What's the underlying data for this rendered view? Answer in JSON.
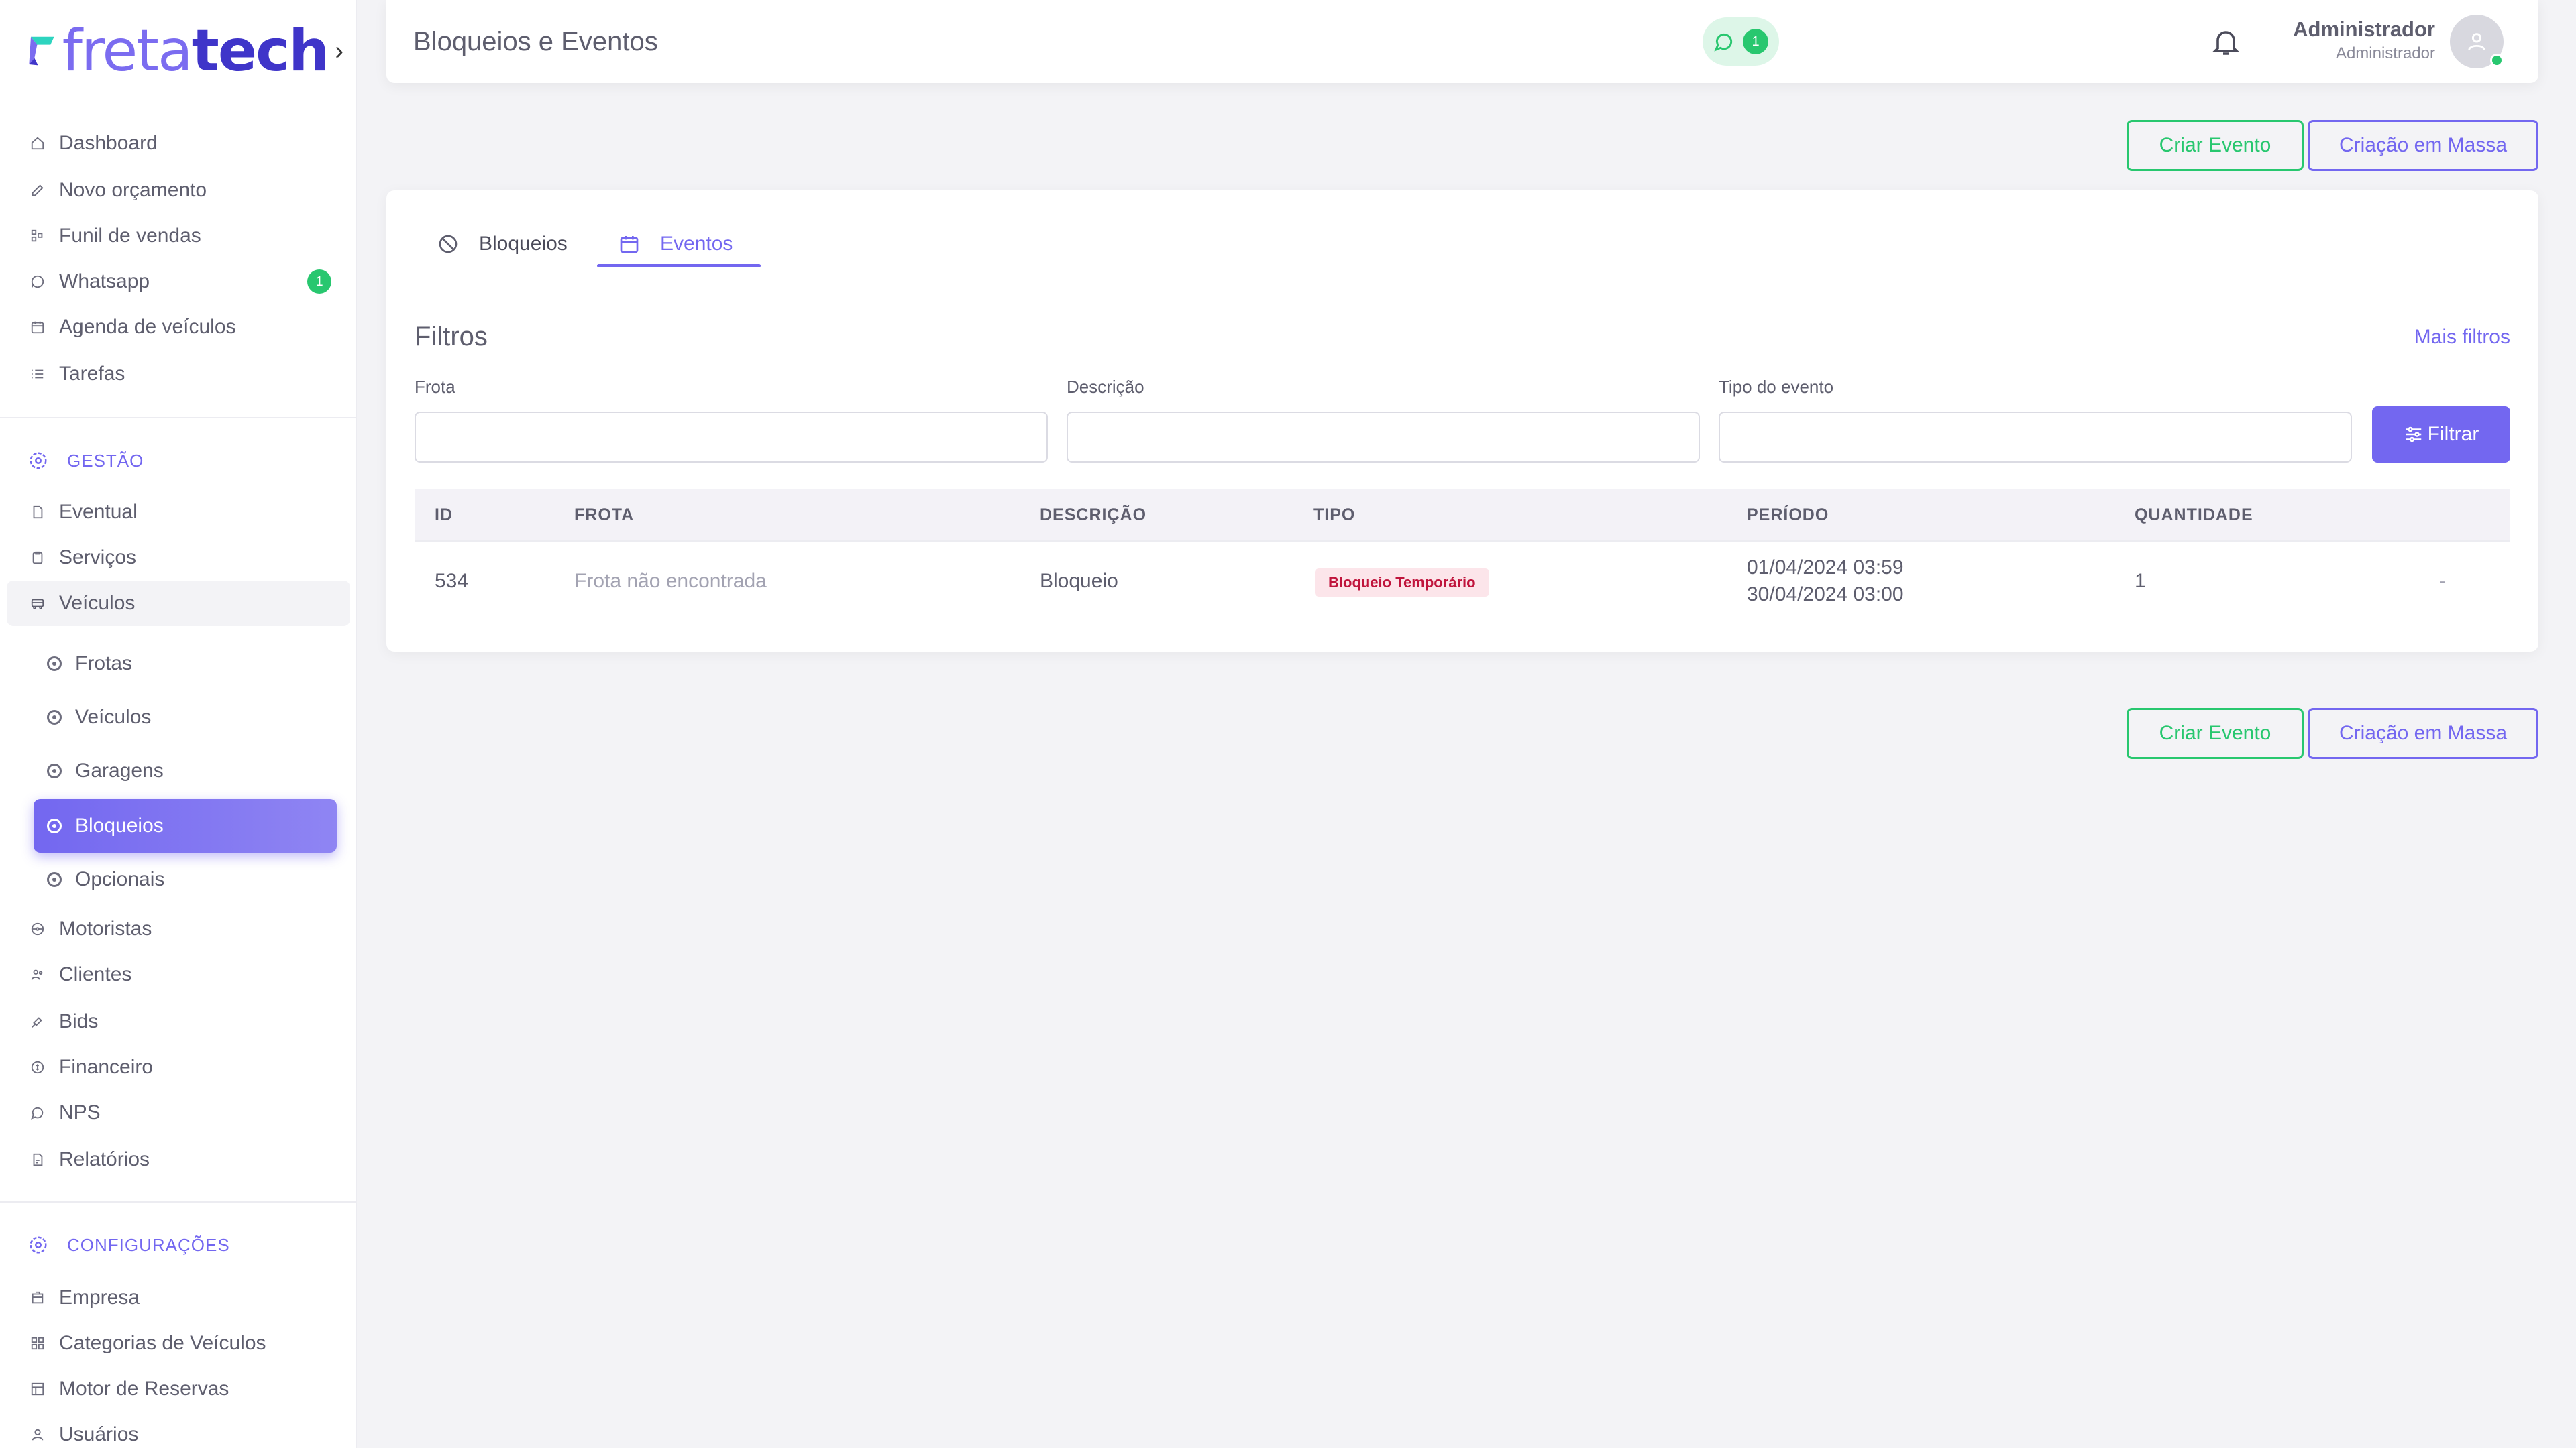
{
  "logo": {
    "part1": "freta",
    "part2": "tech",
    "chevron": "›"
  },
  "sidebar": {
    "items": [
      {
        "label": "Dashboard",
        "icon": "home-icon"
      },
      {
        "label": "Novo orçamento",
        "icon": "edit-icon"
      },
      {
        "label": "Funil de vendas",
        "icon": "funnel-icon"
      },
      {
        "label": "Whatsapp",
        "icon": "whatsapp-icon",
        "badge": "1"
      },
      {
        "label": "Agenda de veículos",
        "icon": "calendar-icon"
      },
      {
        "label": "Tarefas",
        "icon": "list-icon"
      }
    ],
    "section_gestao": "GESTÃO",
    "gestao_items": [
      {
        "label": "Eventual",
        "icon": "file-icon"
      },
      {
        "label": "Serviços",
        "icon": "clipboard-icon"
      },
      {
        "label": "Veículos",
        "icon": "bus-icon"
      }
    ],
    "veiculos_sub": [
      {
        "label": "Frotas"
      },
      {
        "label": "Veículos"
      },
      {
        "label": "Garagens"
      },
      {
        "label": "Bloqueios"
      },
      {
        "label": "Opcionais"
      }
    ],
    "gestao_more": [
      {
        "label": "Motoristas",
        "icon": "steering-icon"
      },
      {
        "label": "Clientes",
        "icon": "users-icon"
      },
      {
        "label": "Bids",
        "icon": "gavel-icon"
      },
      {
        "label": "Financeiro",
        "icon": "coin-icon"
      },
      {
        "label": "NPS",
        "icon": "chat-icon"
      },
      {
        "label": "Relatórios",
        "icon": "report-icon"
      }
    ],
    "section_config": "CONFIGURAÇÕES",
    "config_items": [
      {
        "label": "Empresa",
        "icon": "building-icon"
      },
      {
        "label": "Categorias de Veículos",
        "icon": "grid-icon"
      },
      {
        "label": "Motor de Reservas",
        "icon": "table-icon"
      },
      {
        "label": "Usuários",
        "icon": "user-icon"
      }
    ]
  },
  "header": {
    "title": "Bloqueios e Eventos",
    "whatsapp_count": "1",
    "user_name": "Administrador",
    "user_role": "Administrador"
  },
  "actions": {
    "create_event": "Criar Evento",
    "bulk_create": "Criação em Massa"
  },
  "tabs": [
    {
      "label": "Bloqueios"
    },
    {
      "label": "Eventos"
    }
  ],
  "filters": {
    "title": "Filtros",
    "more": "Mais filtros",
    "frota_label": "Frota",
    "descricao_label": "Descrição",
    "tipo_label": "Tipo do evento",
    "submit": "Filtrar"
  },
  "table": {
    "columns": [
      "ID",
      "FROTA",
      "DESCRIÇÃO",
      "TIPO",
      "PERÍODO",
      "QUANTIDADE"
    ],
    "rows": [
      {
        "id": "534",
        "frota": "Frota não encontrada",
        "descricao": "Bloqueio",
        "tipo": "Bloqueio Temporário",
        "periodo_inicio": "01/04/2024 03:59",
        "periodo_fim": "30/04/2024 03:00",
        "quantidade": "1",
        "acao": "-"
      }
    ]
  },
  "colors": {
    "primary": "#7367f0",
    "success": "#28c76f",
    "danger": "#c0143c"
  }
}
